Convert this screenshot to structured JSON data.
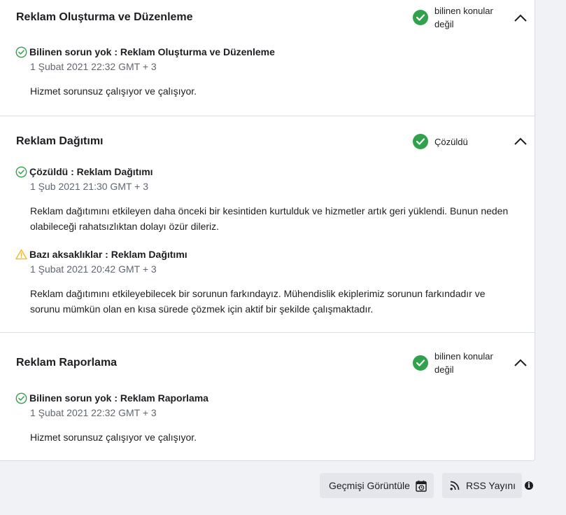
{
  "sections": [
    {
      "title": "Reklam Oluşturma ve Düzenleme",
      "status": "bilinen konular değil",
      "items": [
        {
          "icon": "check-circle-icon",
          "title": "Bilinen sorun yok : Reklam Oluşturma ve Düzenleme",
          "date": "1 Şubat 2021 22:32 GMT + 3",
          "body": "Hizmet sorunsuz çalışıyor ve çalışıyor."
        }
      ]
    },
    {
      "title": "Reklam Dağıtımı",
      "status": "Çözüldü",
      "items": [
        {
          "icon": "check-circle-icon",
          "title": "Çözüldü : Reklam Dağıtımı",
          "date": "1 Şub 2021 21:30 GMT + 3",
          "body": "Reklam dağıtımını etkileyen daha önceki bir kesintiden kurtulduk ve hizmetler artık geri yüklendi. Bunun neden olabileceği rahatsızlıktan dolayı özür dileriz."
        },
        {
          "icon": "warning-icon",
          "title": "Bazı aksaklıklar : Reklam Dağıtımı",
          "date": "1 Şubat 2021 20:42 GMT + 3",
          "body": "Reklam dağıtımını etkileyebilecek bir sorunun farkındayız. Mühendislik ekiplerimiz sorunun farkındadır ve sorunu mümkün olan en kısa sürede çözmek için aktif bir şekilde çalışmaktadır."
        }
      ]
    },
    {
      "title": "Reklam Raporlama",
      "status": "bilinen konular değil",
      "items": [
        {
          "icon": "check-circle-icon",
          "title": "Bilinen sorun yok : Reklam Raporlama",
          "date": "1 Şubat 2021 22:32 GMT + 3",
          "body": "Hizmet sorunsuz çalışıyor ve çalışıyor."
        }
      ]
    }
  ],
  "footer": {
    "history_label": "Geçmişi Görüntüle",
    "rss_label": "RSS Yayını",
    "info_glyph": "i"
  },
  "colors": {
    "ok_green": "#31a24c",
    "warning_yellow": "#f7b928",
    "muted_text": "#606770"
  }
}
